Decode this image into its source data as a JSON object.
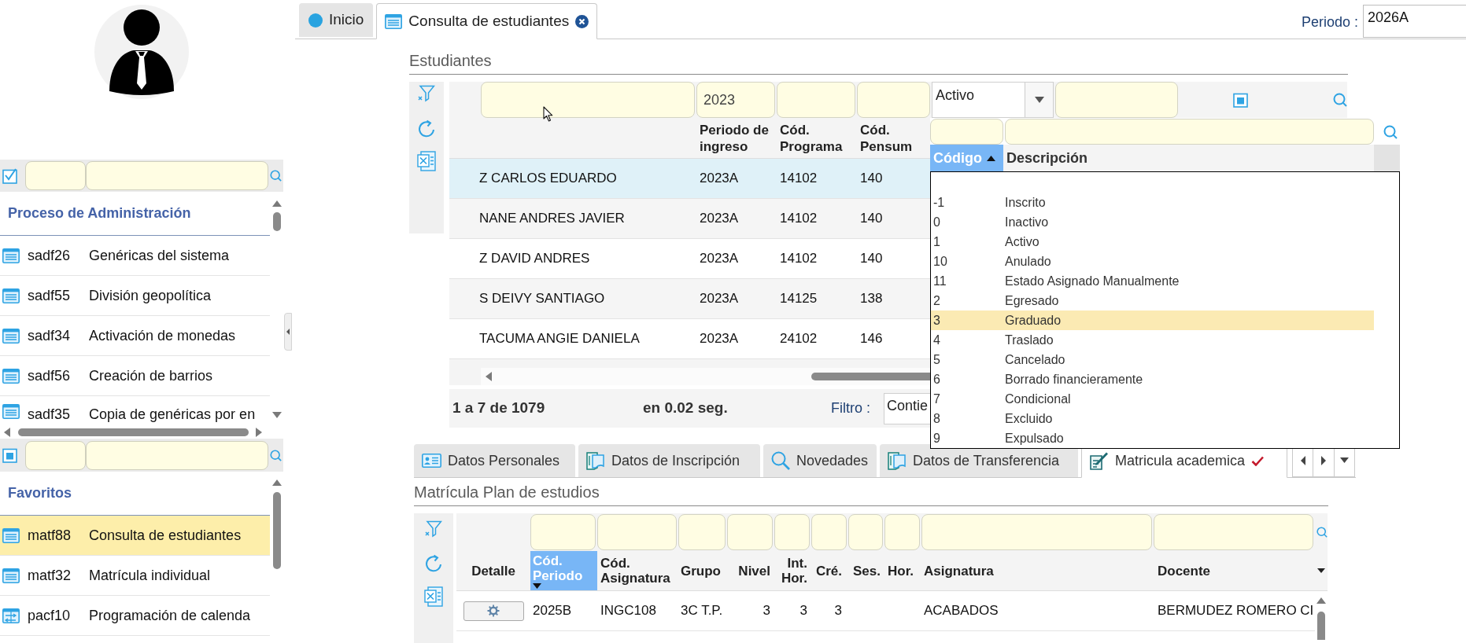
{
  "sidebar": {
    "panels": [
      {
        "checked": true,
        "indeterminate": false,
        "title": "Proceso de Administración",
        "items": [
          {
            "code": "sadf26",
            "label": "Genéricas del sistema",
            "kind": "form",
            "selected": false
          },
          {
            "code": "sadf55",
            "label": "División geopolítica",
            "kind": "form",
            "selected": false
          },
          {
            "code": "sadf34",
            "label": "Activación de monedas",
            "kind": "form",
            "selected": false
          },
          {
            "code": "sadf56",
            "label": "Creación de barrios",
            "kind": "form",
            "selected": false
          },
          {
            "code": "sadf35",
            "label": "Copia de genéricas por en",
            "kind": "form",
            "selected": false
          }
        ]
      },
      {
        "checked": false,
        "indeterminate": true,
        "title": "Favoritos",
        "items": [
          {
            "code": "matf88",
            "label": "Consulta de estudiantes",
            "kind": "form",
            "selected": true
          },
          {
            "code": "matf32",
            "label": "Matrícula individual",
            "kind": "form",
            "selected": false
          },
          {
            "code": "pacf10",
            "label": "Programación de calenda",
            "kind": "schedule",
            "selected": false
          }
        ]
      }
    ]
  },
  "tabs": [
    {
      "label": "Inicio",
      "kind": "home",
      "selected": false,
      "closable": false
    },
    {
      "label": "Consulta de estudiantes",
      "kind": "form",
      "selected": true,
      "closable": true
    }
  ],
  "period": {
    "label": "Periodo :",
    "value": "2026A"
  },
  "students": {
    "title": "Estudiantes",
    "filters": [
      {
        "kind": "text"
      },
      {
        "kind": "text",
        "value": "2023"
      },
      {
        "kind": "text"
      },
      {
        "kind": "text"
      },
      {
        "kind": "select",
        "value": "Activo"
      },
      {
        "kind": "text"
      },
      {
        "kind": "checkbox",
        "checked": false,
        "indeterminate": true
      }
    ],
    "columns": [
      "",
      "Periodo de ingreso",
      "Cód. Programa",
      "Cód. Pensum"
    ],
    "rows": [
      {
        "cells": [
          "Z CARLOS EDUARDO",
          "2023A",
          "14102",
          "140"
        ],
        "selected": true
      },
      {
        "cells": [
          "NANE ANDRES JAVIER",
          "2023A",
          "14102",
          "140"
        ],
        "selected": false
      },
      {
        "cells": [
          "Z DAVID ANDRES",
          "2023A",
          "14102",
          "140"
        ],
        "selected": false
      },
      {
        "cells": [
          "S DEIVY SANTIAGO",
          "2023A",
          "14125",
          "138"
        ],
        "selected": false
      },
      {
        "cells": [
          "TACUMA ANGIE DANIELA",
          "2023A",
          "24102",
          "146"
        ],
        "selected": false
      }
    ],
    "footer": {
      "range": "1 a 7 de 1079",
      "time": "en 0.02 seg.",
      "filter_label": "Filtro :",
      "filter_value": "Contie"
    },
    "dropdown": {
      "columns": [
        {
          "label": "Código",
          "sorted_ascending": true,
          "sorted_descending": false
        },
        {
          "label": "Descripción",
          "sorted_ascending": false,
          "sorted_descending": false
        }
      ],
      "options": [
        {
          "code": "-1",
          "label": "Inscrito",
          "selected": false
        },
        {
          "code": "0",
          "label": "Inactivo",
          "selected": false
        },
        {
          "code": "1",
          "label": "Activo",
          "selected": false
        },
        {
          "code": "10",
          "label": "Anulado",
          "selected": false
        },
        {
          "code": "11",
          "label": "Estado Asignado Manualmente",
          "selected": false
        },
        {
          "code": "2",
          "label": "Egresado",
          "selected": false
        },
        {
          "code": "3",
          "label": "Graduado",
          "selected": true
        },
        {
          "code": "4",
          "label": "Traslado",
          "selected": false
        },
        {
          "code": "5",
          "label": "Cancelado",
          "selected": false
        },
        {
          "code": "6",
          "label": "Borrado financieramente",
          "selected": false
        },
        {
          "code": "7",
          "label": "Condicional",
          "selected": false
        },
        {
          "code": "8",
          "label": "Excluido",
          "selected": false
        },
        {
          "code": "9",
          "label": "Expulsado",
          "selected": false
        }
      ]
    }
  },
  "detail_tabs": [
    {
      "label": "Datos Personales",
      "kind": "id_card",
      "selected": false,
      "checked": false
    },
    {
      "label": "Datos de Inscripción",
      "kind": "document",
      "selected": false,
      "checked": false
    },
    {
      "label": "Novedades",
      "kind": "search",
      "selected": false,
      "checked": false
    },
    {
      "label": "Datos de Transferencia",
      "kind": "document",
      "selected": false,
      "checked": false
    },
    {
      "label": "Matricula academica",
      "kind": "edit",
      "selected": true,
      "checked": true
    }
  ],
  "enrollment": {
    "title": "Matrícula Plan de estudios",
    "columns": [
      {
        "label": "Detalle",
        "filter": false,
        "sorted_ascending": false,
        "sorted_descending": false
      },
      {
        "label": "Cód. Periodo",
        "filter": true,
        "sorted_ascending": false,
        "sorted_descending": true
      },
      {
        "label": "Cód. Asignatura",
        "filter": true,
        "sorted_ascending": false,
        "sorted_descending": false
      },
      {
        "label": "Grupo",
        "filter": true,
        "sorted_ascending": false,
        "sorted_descending": false
      },
      {
        "label": "Nivel",
        "filter": true,
        "sorted_ascending": false,
        "sorted_descending": false
      },
      {
        "label": "Int. Hor.",
        "filter": true,
        "sorted_ascending": false,
        "sorted_descending": false
      },
      {
        "label": "Cré.",
        "filter": true,
        "sorted_ascending": false,
        "sorted_descending": false
      },
      {
        "label": "Ses.",
        "filter": true,
        "sorted_ascending": false,
        "sorted_descending": false
      },
      {
        "label": "Hor.",
        "filter": true,
        "sorted_ascending": false,
        "sorted_descending": false
      },
      {
        "label": "Asignatura",
        "filter": true,
        "sorted_ascending": false,
        "sorted_descending": false
      },
      {
        "label": "Docente",
        "filter": true,
        "sorted_ascending": false,
        "sorted_descending": false
      }
    ],
    "rows": [
      {
        "cells": [
          "",
          "2025B",
          "INGC108",
          "3C T.P.",
          "3",
          "3",
          "3",
          "",
          "",
          "ACABADOS",
          "BERMUDEZ ROMERO CI"
        ]
      }
    ]
  }
}
